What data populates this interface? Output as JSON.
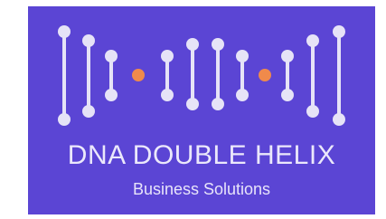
{
  "logo": {
    "title": "DNA DOUBLE HELIX",
    "subtitle": "Business Solutions",
    "colors": {
      "background": "#5b45d4",
      "strand": "#e6e3f7",
      "accent": "#f08a4b",
      "text": "#ebe8fb"
    },
    "icon": "dna-double-helix-icon"
  }
}
